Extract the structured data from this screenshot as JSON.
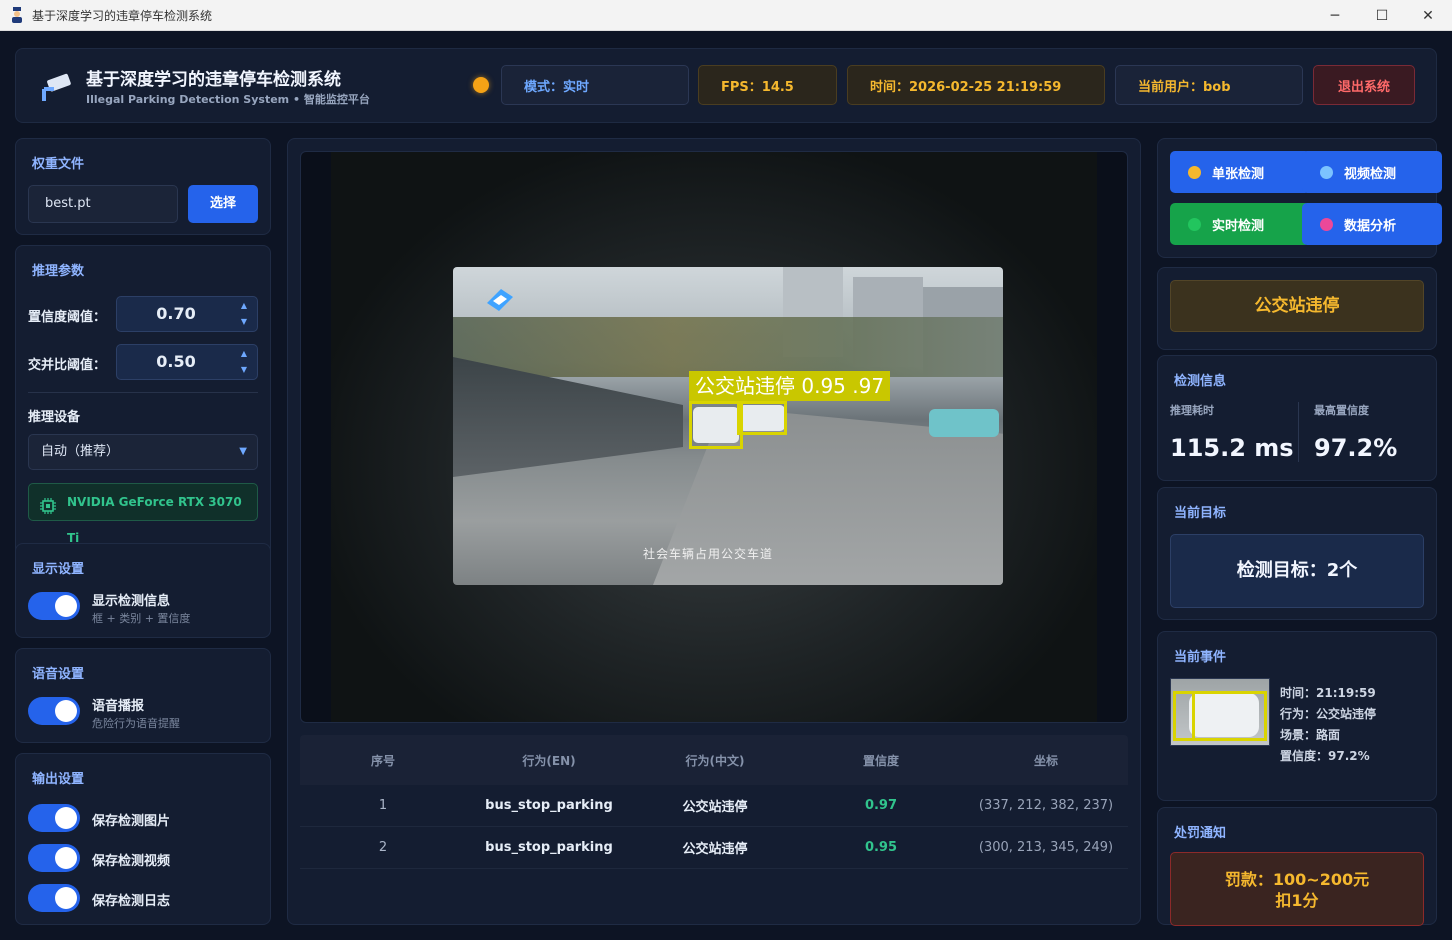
{
  "window": {
    "title": "基于深度学习的违章停车检测系统",
    "minimize": "─",
    "maximize": "☐",
    "close": "✕"
  },
  "header": {
    "title": "基于深度学习的违章停车检测系统",
    "subtitle": "Illegal Parking Detection System • 智能监控平台",
    "mode": "模式：实时",
    "fps": "FPS：14.5",
    "time": "时间：2026-02-25 21:19:59",
    "user": "当前用户：bob",
    "exit": "退出系统",
    "status_color": "#f5a216"
  },
  "weights": {
    "title": "权重文件",
    "file": "best.pt",
    "choose": "选择"
  },
  "inference": {
    "title": "推理参数",
    "conf_label": "置信度阈值：",
    "conf_value": "0.70",
    "iou_label": "交并比阈值：",
    "iou_value": "0.50",
    "device_label": "推理设备",
    "device_value": "自动（推荐）",
    "gpu": "NVIDIA GeForce RTX 3070 Ti"
  },
  "display": {
    "title": "显示设置",
    "toggle_label": "显示检测信息",
    "toggle_sub": "框 + 类别 + 置信度"
  },
  "voice": {
    "title": "语音设置",
    "toggle_label": "语音播报",
    "toggle_sub": "危险行为语音提醒"
  },
  "output": {
    "title": "输出设置",
    "save_image": "保存检测图片",
    "save_video": "保存检测视频",
    "save_log": "保存检测日志"
  },
  "viewer": {
    "box_label": "公交站违停 0.95 .97",
    "caption": "社会车辆占用公交车道"
  },
  "table": {
    "headers": [
      "序号",
      "行为(EN)",
      "行为(中文)",
      "置信度",
      "坐标"
    ],
    "rows": [
      [
        "1",
        "bus_stop_parking",
        "公交站违停",
        "0.97",
        "(337, 212, 382, 237)"
      ],
      [
        "2",
        "bus_stop_parking",
        "公交站违停",
        "0.95",
        "(300, 213, 345, 249)"
      ]
    ]
  },
  "modes": {
    "single": "单张检测",
    "video": "视频检测",
    "realtime": "实时检测",
    "analysis": "数据分析",
    "colors": {
      "blue": "#2563eb",
      "green": "#16a34a",
      "yellow_dot": "#f5b82e",
      "light_dot": "#7cc3ff",
      "green_dot": "#22c55e",
      "pink_dot": "#ec4899"
    }
  },
  "violation": {
    "label": "公交站违停"
  },
  "detection_info": {
    "title": "检测信息",
    "time_label": "推理耗时",
    "time_value": "115.2 ms",
    "conf_label": "最高置信度",
    "conf_value": "97.2%"
  },
  "target": {
    "title": "当前目标",
    "value": "检测目标：2个"
  },
  "event": {
    "title": "当前事件",
    "time": "时间：21:19:59",
    "behavior": "行为：公交站违停",
    "scene": "场景：路面",
    "confidence": "置信度：97.2%"
  },
  "penalty": {
    "title": "处罚通知",
    "fine": "罚款：100~200元",
    "points": "扣1分"
  }
}
